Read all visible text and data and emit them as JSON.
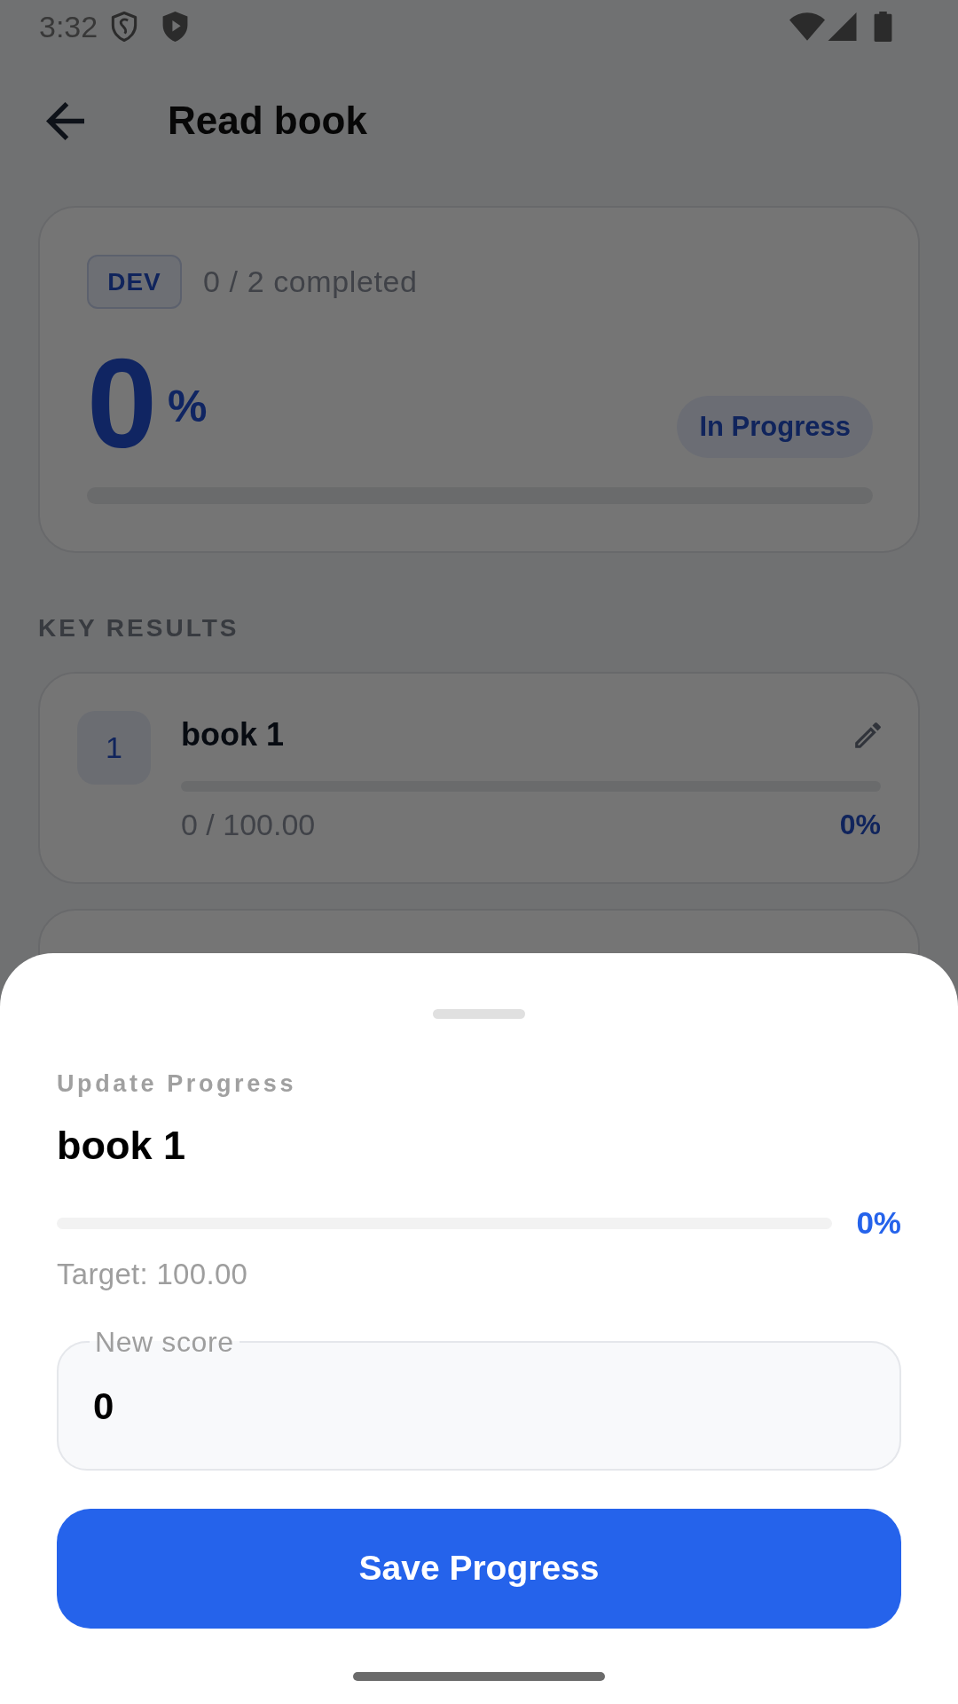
{
  "status_bar": {
    "time": "3:32"
  },
  "header": {
    "title": "Read book"
  },
  "objective": {
    "tag": "DEV",
    "completed": "0 / 2 completed",
    "percent": "0",
    "percent_sign": "%",
    "status": "In Progress"
  },
  "key_results_heading": "KEY RESULTS",
  "key_results": [
    {
      "kind": "full",
      "number": "1",
      "title": "book 1",
      "score": "0 / 100.00",
      "percent": "0%"
    },
    {
      "kind": "covered"
    }
  ],
  "sheet": {
    "eyebrow": "Update Progress",
    "title": "book 1",
    "percent": "0%",
    "target": "Target: 100.00",
    "field": {
      "label": "New score",
      "value": "0"
    },
    "button": "Save Progress"
  }
}
